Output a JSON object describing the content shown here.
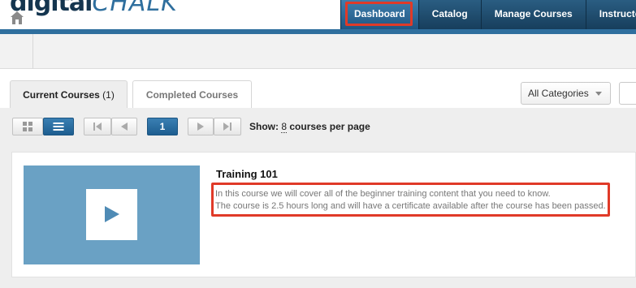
{
  "header": {
    "logo_part1": "digital",
    "logo_part2": "CHALK",
    "nav": [
      {
        "label": "Dashboard"
      },
      {
        "label": "Catalog"
      },
      {
        "label": "Manage Courses"
      },
      {
        "label": "Instructo"
      }
    ]
  },
  "tabs": {
    "current_label": "Current Courses",
    "current_count": "(1)",
    "completed_label": "Completed Courses"
  },
  "filters": {
    "category_selected": "All Categories"
  },
  "toolbar": {
    "current_page": "1",
    "show_prefix": "Show:",
    "per_page": "8",
    "show_suffix": "courses per page"
  },
  "course": {
    "title": "Training 101",
    "desc_line1": "In this course we will cover all of the beginner training content that you need to know.",
    "desc_line2": "The course is 2.5 hours long and will have a certificate available after the course has been passed."
  },
  "colors": {
    "nav_dark": "#173e5c",
    "accent_blue": "#2f6f9e",
    "thumbnail": "#6aa1c4",
    "highlight_red": "#e03a28"
  },
  "icons": [
    "home-icon",
    "grid-view-icon",
    "list-view-icon",
    "first-page-icon",
    "prev-page-icon",
    "next-page-icon",
    "last-page-icon",
    "play-icon",
    "chevron-down-icon"
  ]
}
